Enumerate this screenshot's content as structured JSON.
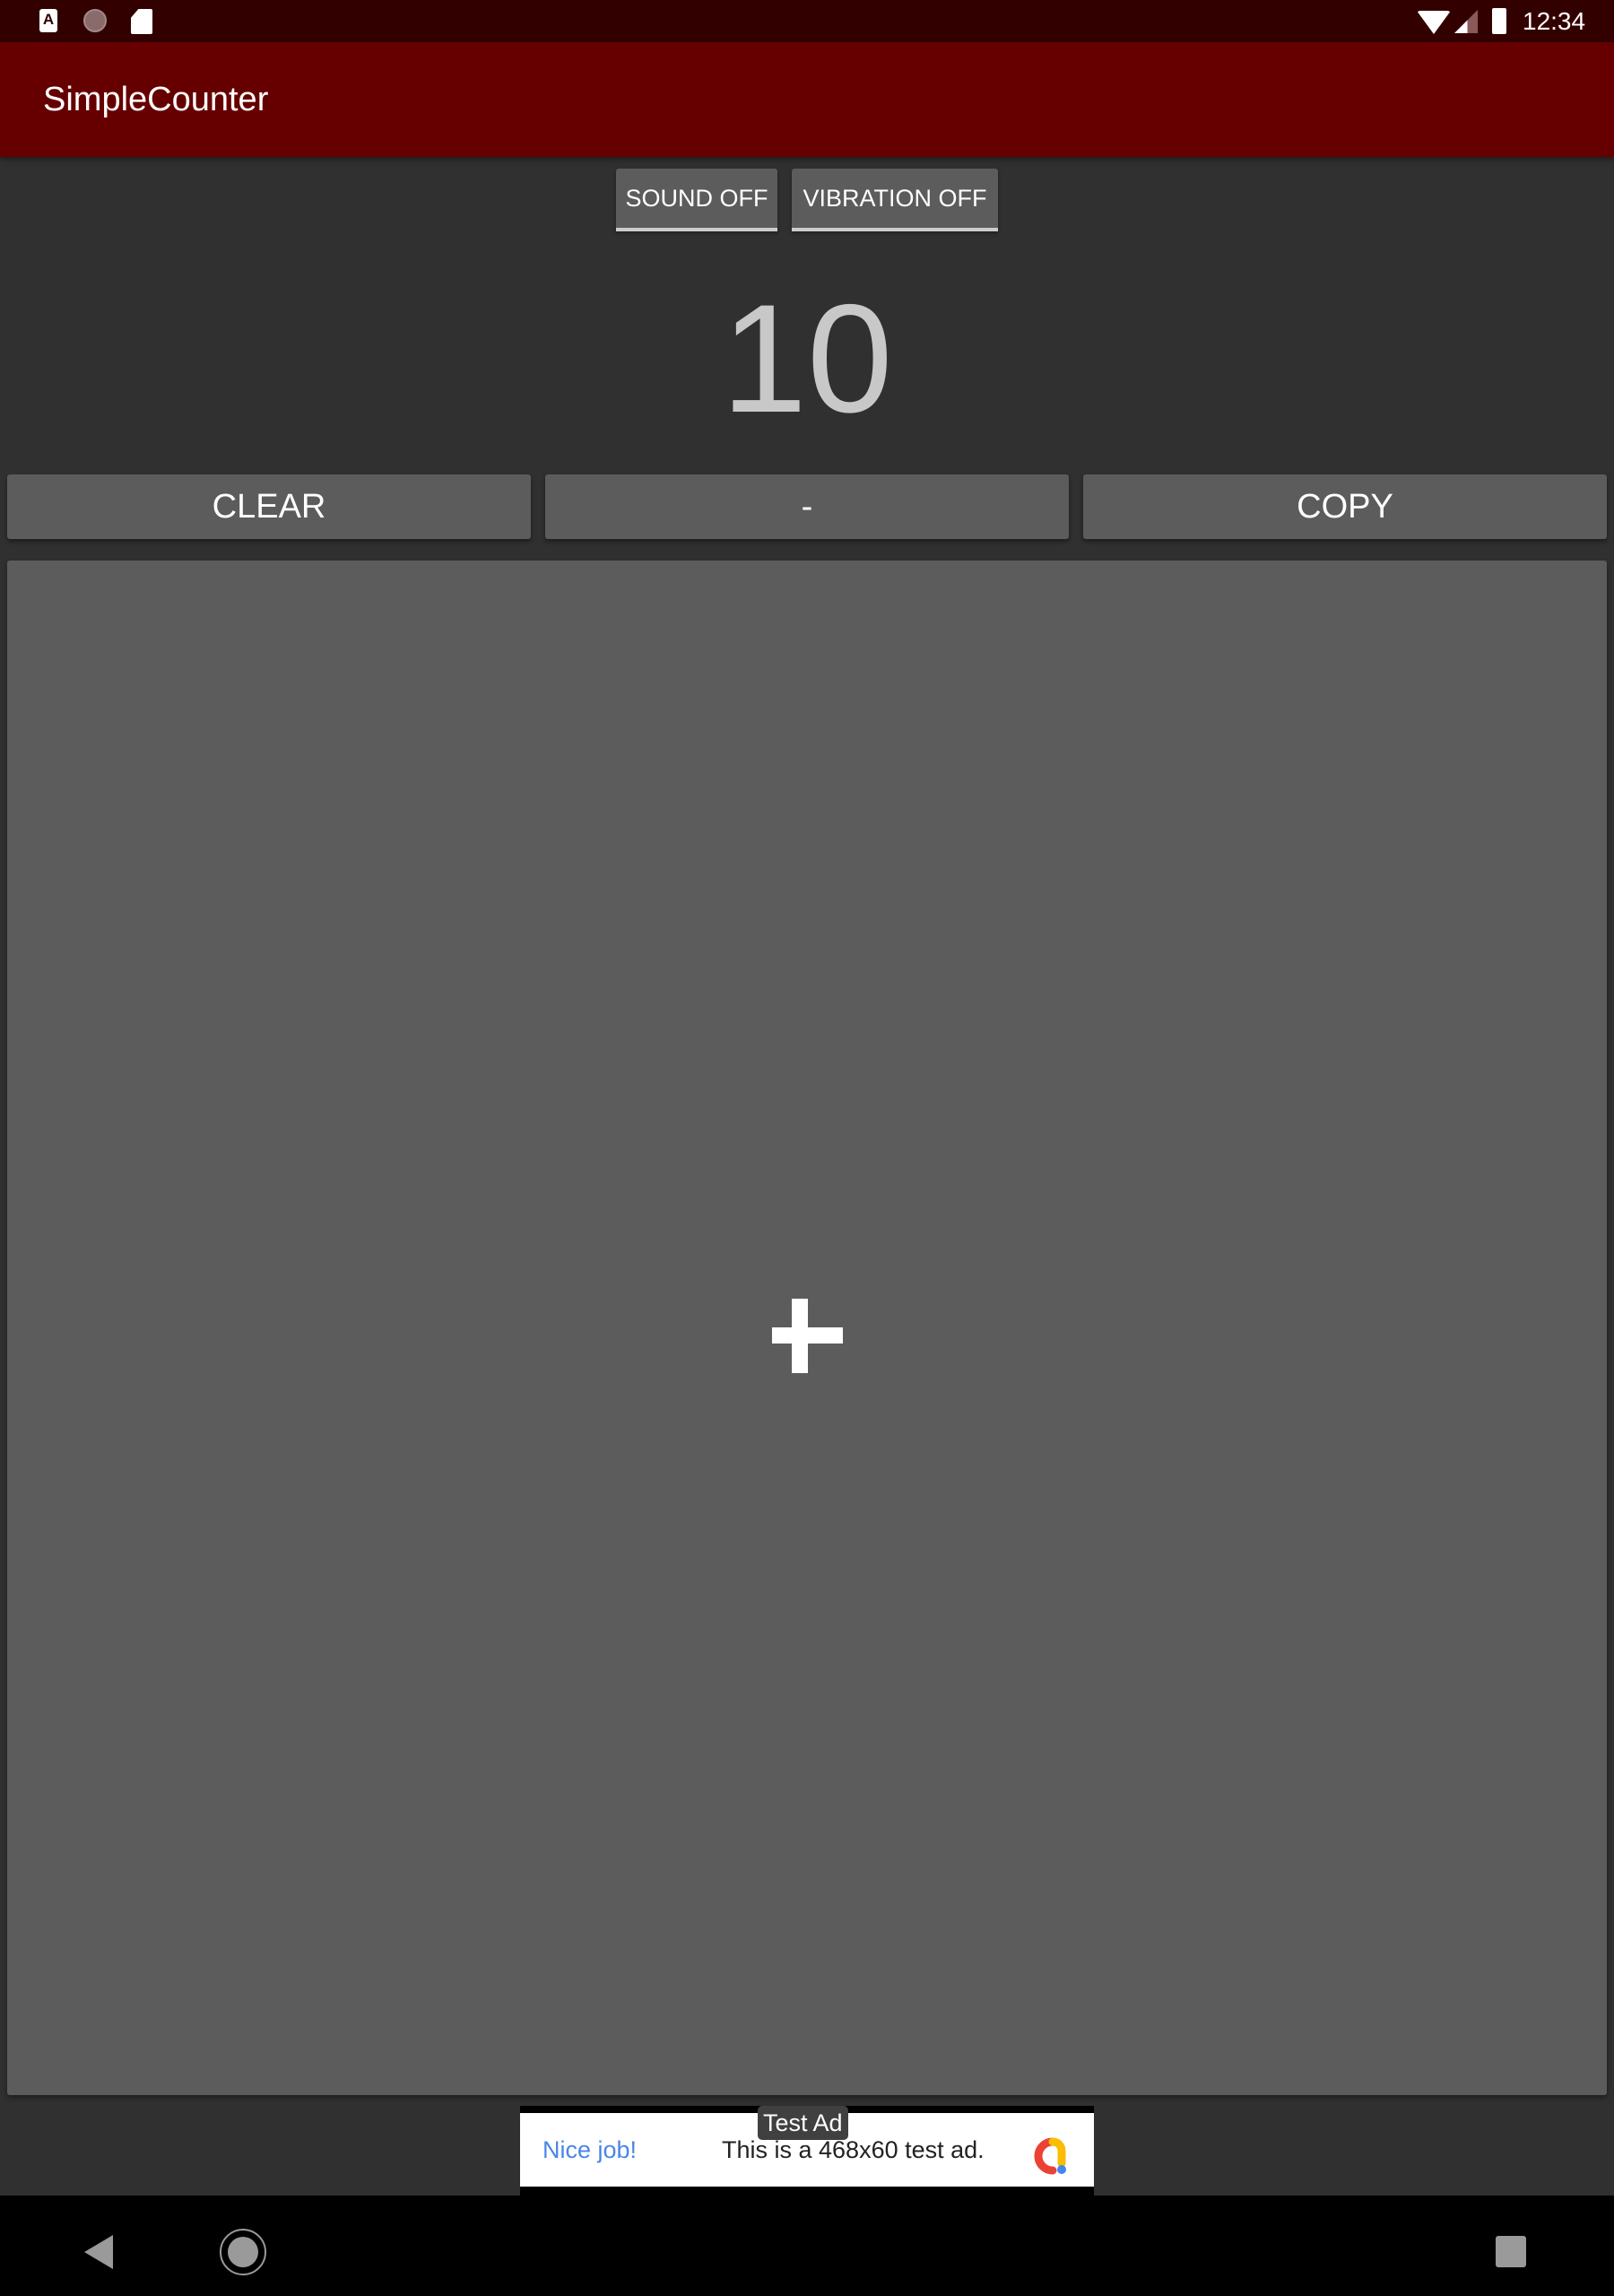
{
  "status_bar": {
    "time": "12:34",
    "left_icons": [
      "accessibility-a-icon",
      "loading-circle-icon",
      "sd-card-icon"
    ],
    "right_icons": [
      "wifi-icon",
      "cell-signal-icon",
      "battery-icon"
    ],
    "a_glyph": "A"
  },
  "app_bar": {
    "title": "SimpleCounter",
    "color": "#660000"
  },
  "toggles": {
    "sound_label": "SOUND OFF",
    "vibration_label": "VIBRATION OFF"
  },
  "counter": {
    "value": "10"
  },
  "actions": {
    "clear_label": "CLEAR",
    "minus_label": "-",
    "copy_label": "COPY",
    "plus_icon": "plus-icon"
  },
  "ad": {
    "badge": "Test Ad",
    "headline": "Nice job!",
    "body": "This is a 468x60 test ad.",
    "headline_color": "#4a86e8"
  },
  "nav_bar": {
    "buttons": [
      "back-icon",
      "home-icon",
      "recents-icon"
    ]
  }
}
